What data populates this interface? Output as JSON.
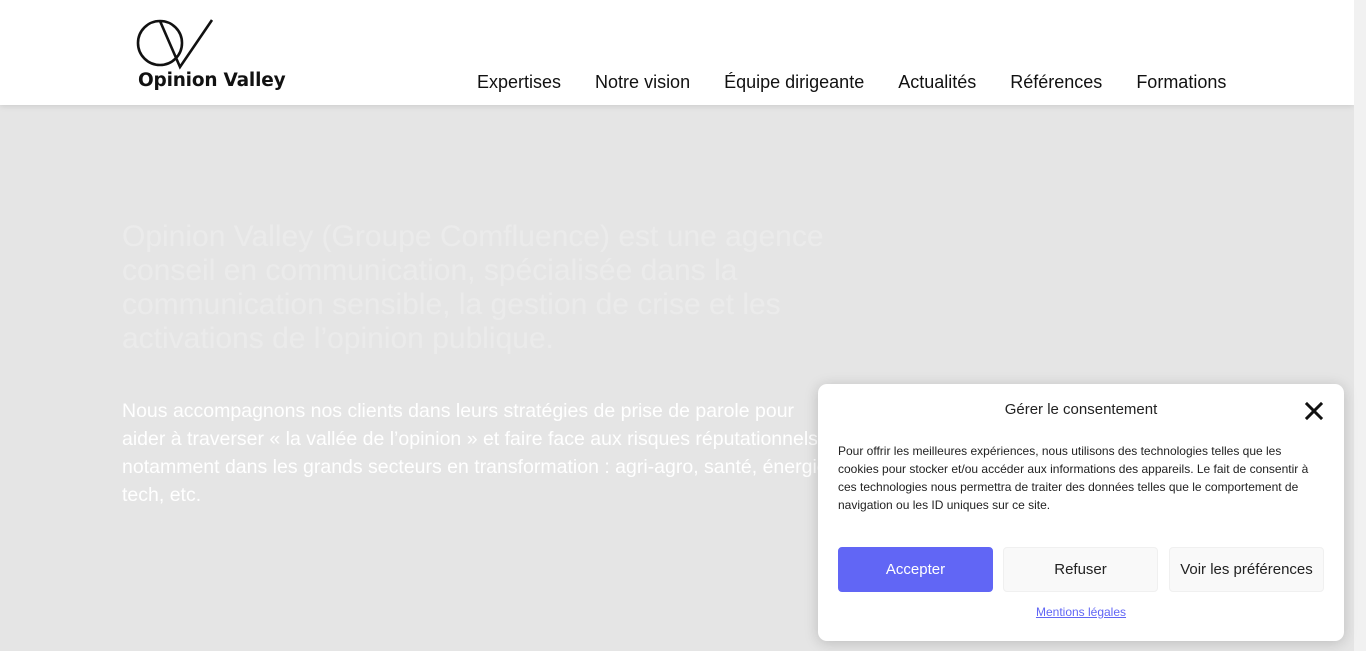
{
  "header": {
    "logo_text": "Opinion Valley",
    "nav": [
      {
        "label": "Expertises"
      },
      {
        "label": "Notre vision"
      },
      {
        "label": "Équipe dirigeante"
      },
      {
        "label": "Actualités"
      },
      {
        "label": "Références"
      },
      {
        "label": "Formations"
      }
    ]
  },
  "hero": {
    "heading": "Opinion Valley (Groupe Comfluence) est une agence conseil en communication, spécialisée dans la communication sensible, la gestion de crise et les activations de l’opinion publique.",
    "body": "Nous accompagnons nos clients dans leurs stratégies de prise de parole pour aider à traverser « la vallée de l’opinion » et faire face aux risques réputationnels, notamment dans les grands secteurs en transformation : agri-agro, santé, énergie, tech, etc."
  },
  "consent": {
    "title": "Gérer le consentement",
    "text": "Pour offrir les meilleures expériences, nous utilisons des technologies telles que les cookies pour stocker et/ou accéder aux informations des appareils. Le fait de consentir à ces technologies nous permettra de traiter des données telles que le comportement de navigation ou les ID uniques sur ce site.",
    "accept_label": "Accepter",
    "refuse_label": "Refuser",
    "prefs_label": "Voir les préférences",
    "legal_label": "Mentions légales",
    "close_icon": "close-icon"
  },
  "colors": {
    "accent": "#6166f5",
    "background": "#e5e5e5",
    "header": "#ffffff"
  }
}
